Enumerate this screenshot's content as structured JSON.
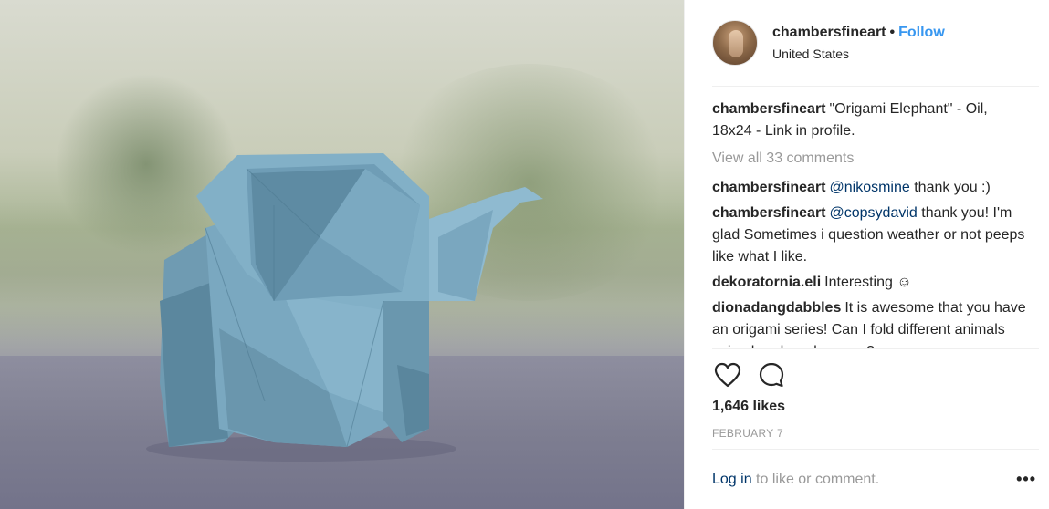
{
  "post": {
    "username": "chambersfineart",
    "separator": "•",
    "follow_label": "Follow",
    "location": "United States",
    "caption": {
      "author": "chambersfineart",
      "text": "\"Origami Elephant\" - Oil, 18x24 - Link in profile."
    },
    "view_all_comments": "View all 33 comments",
    "comments": [
      {
        "author": "chambersfineart",
        "mention": "@nikosmine",
        "text": " thank you :)"
      },
      {
        "author": "chambersfineart",
        "mention": "@copsydavid",
        "text": " thank you! I'm glad Sometimes i question weather or not peeps like what I like."
      },
      {
        "author": "dekoratornia.eli",
        "mention": "",
        "text": "Interesting ☺"
      },
      {
        "author": "dionadangdabbles",
        "mention": "",
        "text": "It is awesome that you have an origami series! Can I fold different animals using hand-made paper?"
      }
    ],
    "likes": "1,646 likes",
    "date": "FEBRUARY 7",
    "footer": {
      "login_label": "Log in",
      "rest": " to like or comment."
    },
    "more_label": "•••",
    "icons": {
      "like": "heart-icon",
      "comment": "comment-icon",
      "more": "more-options-icon"
    },
    "colors": {
      "link_blue": "#3897f0",
      "mention_navy": "#003569",
      "muted": "#999999",
      "text": "#262626"
    }
  }
}
